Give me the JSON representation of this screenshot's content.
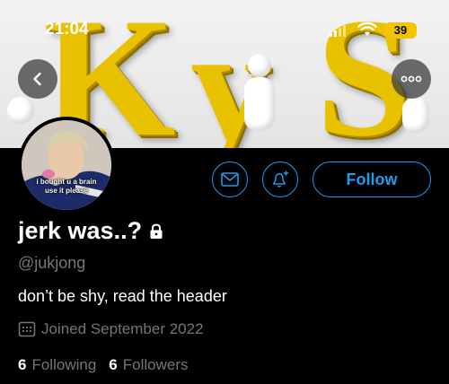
{
  "status_bar": {
    "time": "21:04",
    "battery": "39"
  },
  "header_image": {
    "letters": [
      "K",
      "y",
      "S"
    ],
    "accent": "#e8c200"
  },
  "avatar": {
    "caption_line1": "i bought u a brain",
    "caption_line2": "use it please"
  },
  "actions": {
    "follow_label": "Follow"
  },
  "profile": {
    "name": "jerk was..?",
    "handle": "@jukjong",
    "bio": "don’t be shy, read the header",
    "joined": "Joined September 2022",
    "following_count": "6",
    "following_label": "Following",
    "followers_count": "6",
    "followers_label": "Followers"
  },
  "colors": {
    "accent": "#1d9bf0",
    "muted": "#71767b",
    "background": "#000000"
  },
  "icons": [
    "back-arrow-icon",
    "more-icon",
    "message-icon",
    "notification-bell-icon",
    "lock-icon",
    "calendar-icon",
    "signal-icon",
    "wifi-icon"
  ]
}
